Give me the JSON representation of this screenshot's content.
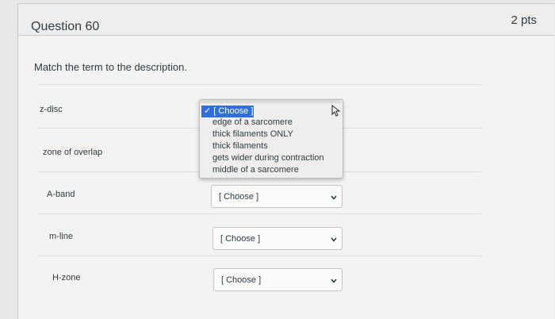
{
  "question": {
    "title": "Question 60",
    "points": "2 pts",
    "prompt": "Match the term to the description."
  },
  "rows": [
    {
      "term": "z-disc",
      "selected": "[ Choose ]"
    },
    {
      "term": "zone of overlap",
      "selected": "[ Choose ]"
    },
    {
      "term": "A-band",
      "selected": "[ Choose ]"
    },
    {
      "term": "m-line",
      "selected": "[ Choose ]"
    },
    {
      "term": "H-zone",
      "selected": "[ Choose ]"
    }
  ],
  "dropdown": {
    "selected": "✓ [ Choose ]",
    "options": [
      "edge of a sarcomere",
      "thick filaments ONLY",
      "thick filaments",
      "gets wider during contraction",
      "middle of a sarcomere"
    ]
  },
  "colors": {
    "selection": "#2f6fd6",
    "text": "#2d3b45",
    "background": "#f4f3f1"
  }
}
